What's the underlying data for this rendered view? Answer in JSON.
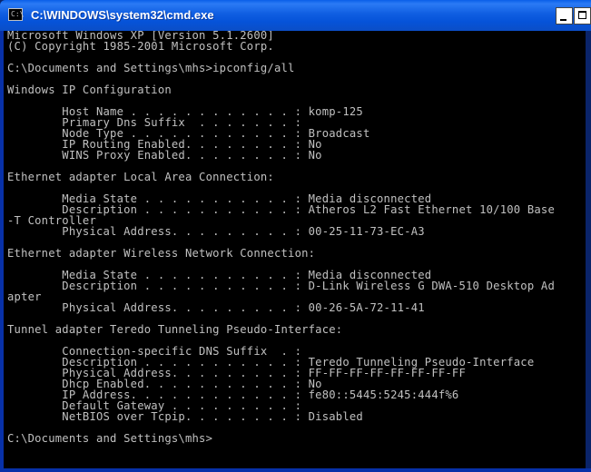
{
  "window": {
    "title": "C:\\WINDOWS\\system32\\cmd.exe",
    "icon": "cmd-icon",
    "icon_glyph": "C:\\",
    "buttons": [
      "minimize-button",
      "maximize-button"
    ]
  },
  "console": {
    "text_color": "#c0c0c0",
    "background": "#000000",
    "lines": [
      "Microsoft Windows XP [Version 5.1.2600]",
      "(C) Copyright 1985-2001 Microsoft Corp.",
      "",
      "C:\\Documents and Settings\\mhs>ipconfig/all",
      "",
      "Windows IP Configuration",
      "",
      "        Host Name . . . . . . . . . . . . : komp-125",
      "        Primary Dns Suffix  . . . . . . . :",
      "        Node Type . . . . . . . . . . . . : Broadcast",
      "        IP Routing Enabled. . . . . . . . : No",
      "        WINS Proxy Enabled. . . . . . . . : No",
      "",
      "Ethernet adapter Local Area Connection:",
      "",
      "        Media State . . . . . . . . . . . : Media disconnected",
      "        Description . . . . . . . . . . . : Atheros L2 Fast Ethernet 10/100 Base",
      "-T Controller",
      "        Physical Address. . . . . . . . . : 00-25-11-73-EC-A3",
      "",
      "Ethernet adapter Wireless Network Connection:",
      "",
      "        Media State . . . . . . . . . . . : Media disconnected",
      "        Description . . . . . . . . . . . : D-Link Wireless G DWA-510 Desktop Ad",
      "apter",
      "        Physical Address. . . . . . . . . : 00-26-5A-72-11-41",
      "",
      "Tunnel adapter Teredo Tunneling Pseudo-Interface:",
      "",
      "        Connection-specific DNS Suffix  . :",
      "        Description . . . . . . . . . . . : Teredo Tunneling Pseudo-Interface",
      "        Physical Address. . . . . . . . . : FF-FF-FF-FF-FF-FF-FF-FF",
      "        Dhcp Enabled. . . . . . . . . . . : No",
      "        IP Address. . . . . . . . . . . . : fe80::5445:5245:444f%6",
      "        Default Gateway . . . . . . . . . :",
      "        NetBIOS over Tcpip. . . . . . . . : Disabled",
      "",
      "C:\\Documents and Settings\\mhs>"
    ]
  }
}
